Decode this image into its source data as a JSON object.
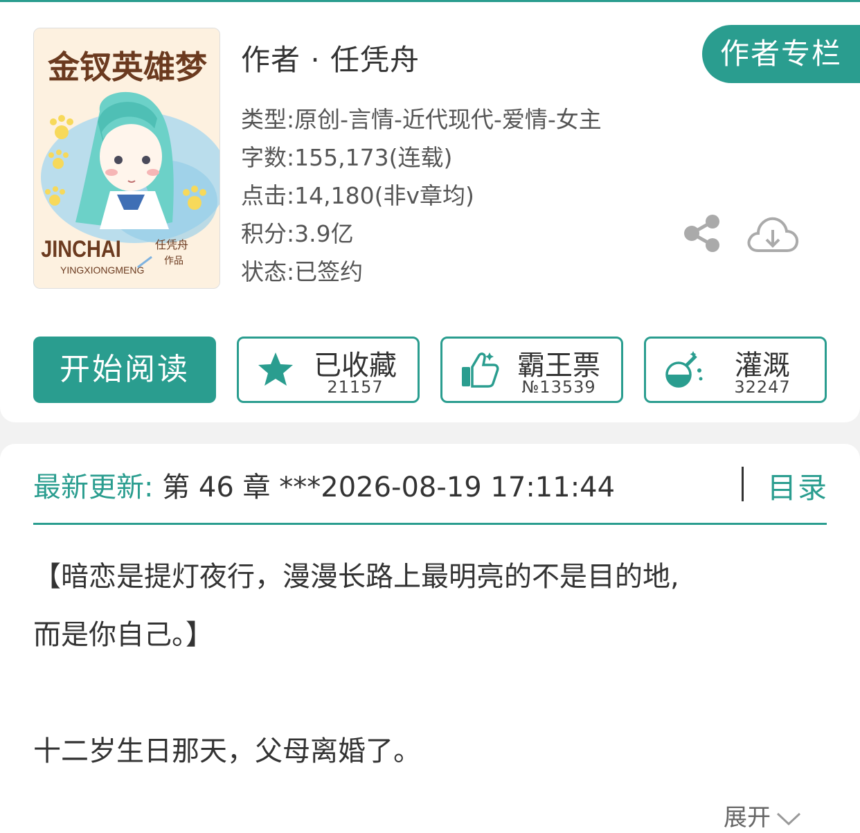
{
  "book": {
    "author_line": "作者 · 任凭舟",
    "author_column_button": "作者专栏",
    "cover": {
      "title_art": "金钗英雄梦",
      "title_latin": "JINCHAI",
      "subtitle_latin": "YINGXIONGMENG",
      "author_sign": "任凭舟",
      "works_sign": "作品"
    },
    "meta": [
      "类型:原创-言情-近代现代-爱情-女主",
      "字数:155,173(连载)",
      "点击:14,180(非v章均)",
      "积分:3.9亿",
      "状态:已签约"
    ]
  },
  "actions": {
    "read": "开始阅读",
    "collect": {
      "label": "已收藏",
      "count": "21157"
    },
    "vote": {
      "label": "霸王票",
      "count": "№13539"
    },
    "water": {
      "label": "灌溉",
      "count": "32247"
    }
  },
  "latest": {
    "label": "最新更新:",
    "value": " 第 46 章 ***2026-08-19 17:11:44",
    "toc": "目录"
  },
  "intro": {
    "line1": "【暗恋是提灯夜行，漫漫长路上最明亮的不是目的地,",
    "line2": "而是你自己。】",
    "line3": "十二岁生日那天，父母离婚了。",
    "expand": "展开"
  },
  "colors": {
    "accent": "#2a9d8f",
    "text": "#333333",
    "muted": "#555555",
    "background": "#f2f2f2"
  },
  "icons": [
    "star-icon",
    "thumbs-up-icon",
    "flask-icon",
    "share-icon",
    "cloud-download-icon",
    "chevron-down-icon"
  ]
}
